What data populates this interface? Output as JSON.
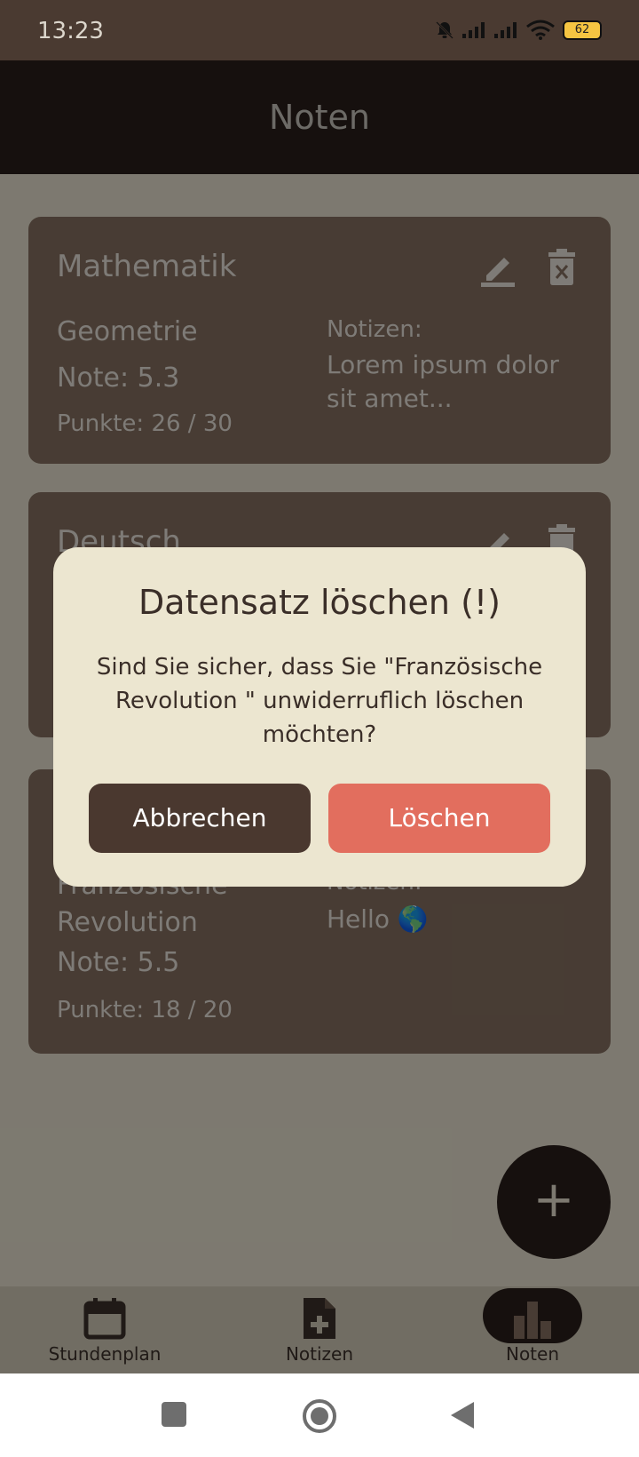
{
  "status": {
    "time": "13:23",
    "battery": "62"
  },
  "app_bar": {
    "title": "Noten"
  },
  "cards": [
    {
      "subject": "Mathematik",
      "topic": "Geometrie",
      "grade": "Note: 5.3",
      "points": "Punkte: 26 / 30",
      "notes_label": "Notizen:",
      "notes_text": "Lorem ipsum dolor sit amet..."
    },
    {
      "subject": "Deutsch"
    },
    {
      "topic": "Französische Revolution",
      "grade": "Note: 5.5",
      "points": "Punkte: 18 / 20",
      "notes_label": "Notizen:",
      "notes_text": "Hello 🌎"
    }
  ],
  "fab": {
    "label": "+"
  },
  "bottom_nav": [
    {
      "label": "Stundenplan",
      "icon": "calendar-icon"
    },
    {
      "label": "Notizen",
      "icon": "note-add-icon"
    },
    {
      "label": "Noten",
      "icon": "bar-chart-icon",
      "active": true
    }
  ],
  "dialog": {
    "title": "Datensatz löschen (!)",
    "message": "Sind Sie sicher, dass Sie \"Französische Revolution \" unwiderruflich löschen möchten?",
    "cancel_label": "Abbrechen",
    "delete_label": "Löschen"
  },
  "colors": {
    "background": "#efe9d6",
    "card": "#8a7464",
    "app_bar": "#2b201c",
    "cancel": "#4a382f",
    "delete": "#e26e5e"
  }
}
